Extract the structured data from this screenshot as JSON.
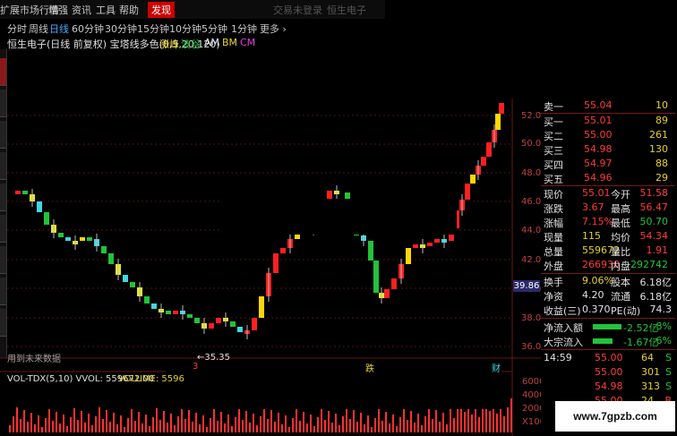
{
  "menu": {
    "items": [
      "扩展市场行情",
      "增强",
      "资讯",
      "工具",
      "帮助",
      "发现"
    ],
    "active_index": 5,
    "center_texts": [
      "交易未登录",
      "恒生电子"
    ]
  },
  "periods": {
    "items": [
      "分时",
      "周线",
      "日线",
      "60分钟",
      "30分钟",
      "15分钟",
      "10分钟",
      "5分钟",
      "1分钟",
      "更多 ›"
    ],
    "active_index": 2
  },
  "indicator": {
    "title": "恒生电子(日线 前复权) 宝塔线多色(0,5,20,120)",
    "tags": [
      "涨峰",
      "·",
      "波谷",
      "·",
      "AM",
      "·",
      "BM",
      "·",
      "CM",
      "·"
    ]
  },
  "chart": {
    "y_labels": [
      "52.00",
      "50.00",
      "48.00",
      "46.00",
      "44.00",
      "42.00",
      "40.00",
      "38.00",
      "36.00"
    ],
    "low_annotation": "←35.35",
    "future_data_label": "用到未来数据",
    "markers": [
      "3",
      "跌",
      "财"
    ],
    "current_price_tag": "39.86"
  },
  "chart_data": {
    "type": "bar",
    "title": "宝塔线多色(0,5,20,120)",
    "ylim": [
      35,
      54
    ],
    "legend": [
      "涨峰",
      "波谷",
      "AM",
      "BM",
      "CM"
    ]
  },
  "volume": {
    "title": "VOL-TDX(5,10) VVOL: 559672.00",
    "volume_label": "VOLUME: 5596",
    "y_labels": [
      "60000",
      "40000",
      "20000",
      "X100"
    ]
  },
  "quote": {
    "asks": [
      {
        "label": "卖一",
        "price": "55.04",
        "qty": "10"
      }
    ],
    "bids": [
      {
        "label": "买一",
        "price": "55.01",
        "qty": "89"
      },
      {
        "label": "买二",
        "price": "55.00",
        "qty": "261"
      },
      {
        "label": "买三",
        "price": "54.98",
        "qty": "130"
      },
      {
        "label": "买四",
        "price": "54.97",
        "qty": "88"
      },
      {
        "label": "买五",
        "price": "54.96",
        "qty": "29"
      }
    ],
    "stats": [
      {
        "l1": "现价",
        "v1": "55.01",
        "l2": "今开",
        "v2": "51.58",
        "c1": "red",
        "c2": "red"
      },
      {
        "l1": "涨跌",
        "v1": "3.67",
        "l2": "最高",
        "v2": "56.47",
        "c1": "red",
        "c2": "red"
      },
      {
        "l1": "涨幅",
        "v1": "7.15%",
        "l2": "最低",
        "v2": "50.70",
        "c1": "red",
        "c2": "green"
      },
      {
        "l1": "现量",
        "v1": "115",
        "l2": "均价",
        "v2": "54.34",
        "c1": "yellow",
        "c2": "red"
      },
      {
        "l1": "总量",
        "v1": "559672",
        "l2": "量比",
        "v2": "1.91",
        "c1": "yellow",
        "c2": "red"
      },
      {
        "l1": "外盘",
        "v1": "266930",
        "l2": "内盘",
        "v2": "292742",
        "c1": "red",
        "c2": "green"
      }
    ],
    "stats2": [
      {
        "l1": "换手",
        "v1": "9.06%",
        "l2": "股本",
        "v2": "6.18亿"
      },
      {
        "l1": "净资",
        "v1": "4.20",
        "l2": "流通",
        "v2": "6.18亿"
      },
      {
        "l1": "收益(三)",
        "v1": "0.370",
        "l2": "PE(动)",
        "v2": "74.3"
      }
    ],
    "flows": [
      {
        "label": "净流入额",
        "value": "-2.52亿",
        "pct": "-8%"
      },
      {
        "label": "大宗流入",
        "value": "-1.67亿",
        "pct": "-6%"
      }
    ],
    "ticks": [
      {
        "time": "14:59",
        "price": "55.00",
        "qty": "64",
        "dir": "S"
      },
      {
        "time": "",
        "price": "55.00",
        "qty": "301",
        "dir": "S"
      },
      {
        "time": "",
        "price": "54.98",
        "qty": "313",
        "dir": "S"
      },
      {
        "time": "",
        "price": "55.00",
        "qty": "24",
        "dir": "B"
      }
    ]
  },
  "watermark": "www.7gpzb.com",
  "colors": {
    "up": "#ff3b3b",
    "down": "#22c33a",
    "accent": "#4aa8ff"
  }
}
